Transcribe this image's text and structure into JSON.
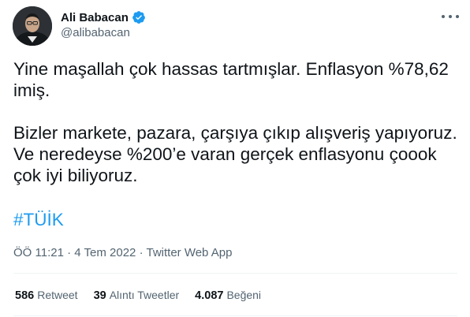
{
  "author": {
    "name": "Ali Babacan",
    "handle": "@alibabacan",
    "verified": true,
    "avatar_icon": "profile-photo"
  },
  "tweet": {
    "lines_p1": [
      "Yine maşallah çok hassas tartmışlar. Enflasyon %78,62",
      "imiş."
    ],
    "lines_p2": [
      "Bizler markete, pazara, çarşıya çıkıp alışveriş yapıyoruz.",
      "Ve neredeyse %200’e varan gerçek enflasyonu çoook",
      "çok iyi biliyoruz."
    ],
    "hashtag": "#TÜİK"
  },
  "meta": {
    "time": "ÖÖ 11:21",
    "sep1": "·",
    "date": "4 Tem 2022",
    "sep2": "·",
    "source": "Twitter Web App"
  },
  "stats": {
    "retweets_num": "586",
    "retweets_label": "Retweet",
    "quotes_num": "39",
    "quotes_label": "Alıntı Tweetler",
    "likes_num": "4.087",
    "likes_label": "Beğeni"
  },
  "colors": {
    "text": "#0f1419",
    "secondary": "#536471",
    "accent": "#1d9bf0",
    "divider": "#eff3f4"
  }
}
